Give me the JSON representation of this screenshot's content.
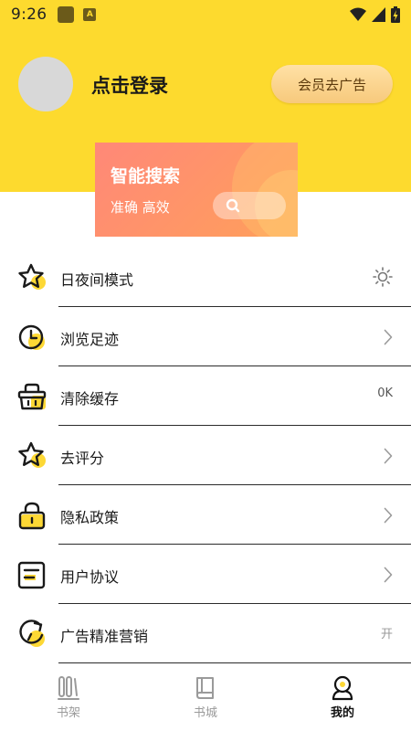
{
  "status": {
    "time": "9:26"
  },
  "profile": {
    "login": "点击登录",
    "vip_button": "会员去广告"
  },
  "banner": {
    "title": "智能搜索",
    "subtitle": "准确 高效"
  },
  "menu": [
    {
      "label": "日夜间模式",
      "icon": "star-icon",
      "right": "sun-icon"
    },
    {
      "label": "浏览足迹",
      "icon": "clock-icon",
      "right": "chevron-right-icon"
    },
    {
      "label": "清除缓存",
      "icon": "basket-icon",
      "value": "0K"
    },
    {
      "label": "去评分",
      "icon": "star-icon",
      "right": "chevron-right-icon"
    },
    {
      "label": "隐私政策",
      "icon": "lock-icon",
      "right": "chevron-right-icon"
    },
    {
      "label": "用户协议",
      "icon": "document-icon",
      "right": "chevron-right-icon"
    },
    {
      "label": "广告精准营销",
      "icon": "refresh-icon",
      "value": "开"
    }
  ],
  "nav": [
    {
      "label": "书架",
      "icon": "bookshelf-icon",
      "active": false
    },
    {
      "label": "书城",
      "icon": "book-icon",
      "active": false
    },
    {
      "label": "我的",
      "icon": "user-icon",
      "active": true
    }
  ],
  "colors": {
    "brand_yellow": "#FDDA2E",
    "icon_yellow": "#FDD835"
  }
}
